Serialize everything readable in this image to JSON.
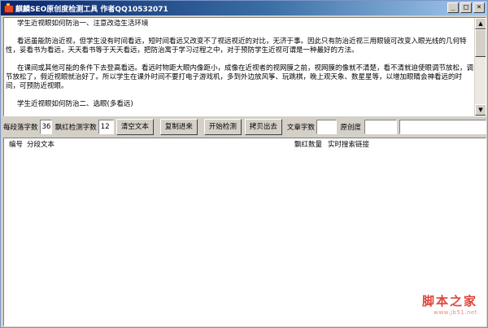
{
  "window": {
    "title": "麒麟SEO原创度检测工具  作者QQ10532071",
    "controls": {
      "minimize": "_",
      "maximize": "□",
      "close": "×"
    }
  },
  "editor": {
    "paragraphs": [
      "学生近视眼如何防治一、注意改造生活环境",
      "看远虽能防治近视，但学生没有时间看远，短时间看远又改变不了视远视近的对比，无济于事。因此只有防治近视三用眼镜可改变入眼光线的几何特性，妥看书为看远，天天看书等于天天看远，把防治寓于学习过程之中，对于预防学生近视可谓是一种最好的方法。",
      "在课间或其他可能的条件下去登高看远。看远时物距大眼内像距小，成像在近视者的视网膜之前，视网膜的像就不清楚，看不清就迫使眼调节放松，调节放松了，假近视眼就治好了。所以学生在课外时间不要打电子游戏机，多到外边放风筝、玩跳棋，晚上观天象、数星星等，以增加眼睛会神看远的时间，可预防近视眼。",
      "学生近视眼如何防治二、选眼(多看远)"
    ]
  },
  "toolbar": {
    "segment_label": "每段落字数",
    "segment_value": "36",
    "red_check_label": "飘红检测字数",
    "red_check_value": "12",
    "clear_button": "清空文本",
    "paste_button": "复制进来",
    "start_button": "开始检测",
    "copy_out_button": "拷贝出去",
    "article_count_label": "文章字数",
    "article_count_value": "",
    "originality_label": "原创度",
    "originality_value": "",
    "extra_value": ""
  },
  "results": {
    "columns": [
      "编号",
      "分段文本",
      "飘红数量",
      "实时搜索链接"
    ]
  },
  "watermark": {
    "logo": "脚本之家",
    "url": "www.jb51.net"
  }
}
